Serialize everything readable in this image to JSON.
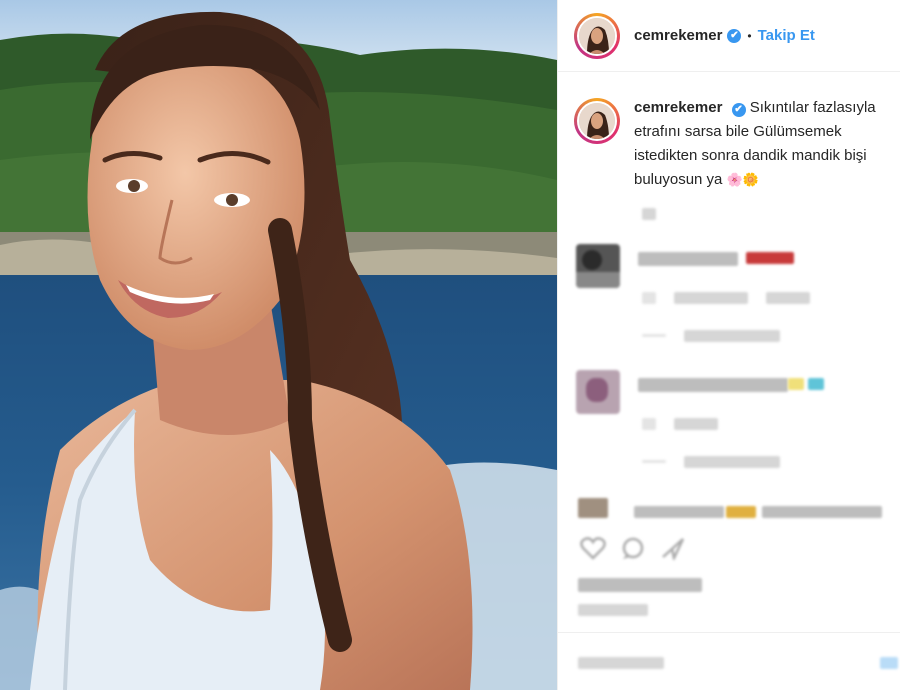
{
  "post": {
    "username": "cemrekemer",
    "verified_mark": "✔",
    "follow_separator": "•",
    "follow_label": "Takip Et",
    "caption_text": "Sıkıntılar fazlasıyla etrafını sarsa bile Gülümsemek istedikten sonra dandik mandik bişi buluyosun ya",
    "caption_emoji": "🌸🌼"
  },
  "colors": {
    "accent": "#3897f0",
    "text": "#262626",
    "divider": "#efefef"
  },
  "icons": {
    "verified": "verified-badge-icon",
    "like": "heart-icon",
    "comment": "comment-icon",
    "share": "share-icon"
  }
}
